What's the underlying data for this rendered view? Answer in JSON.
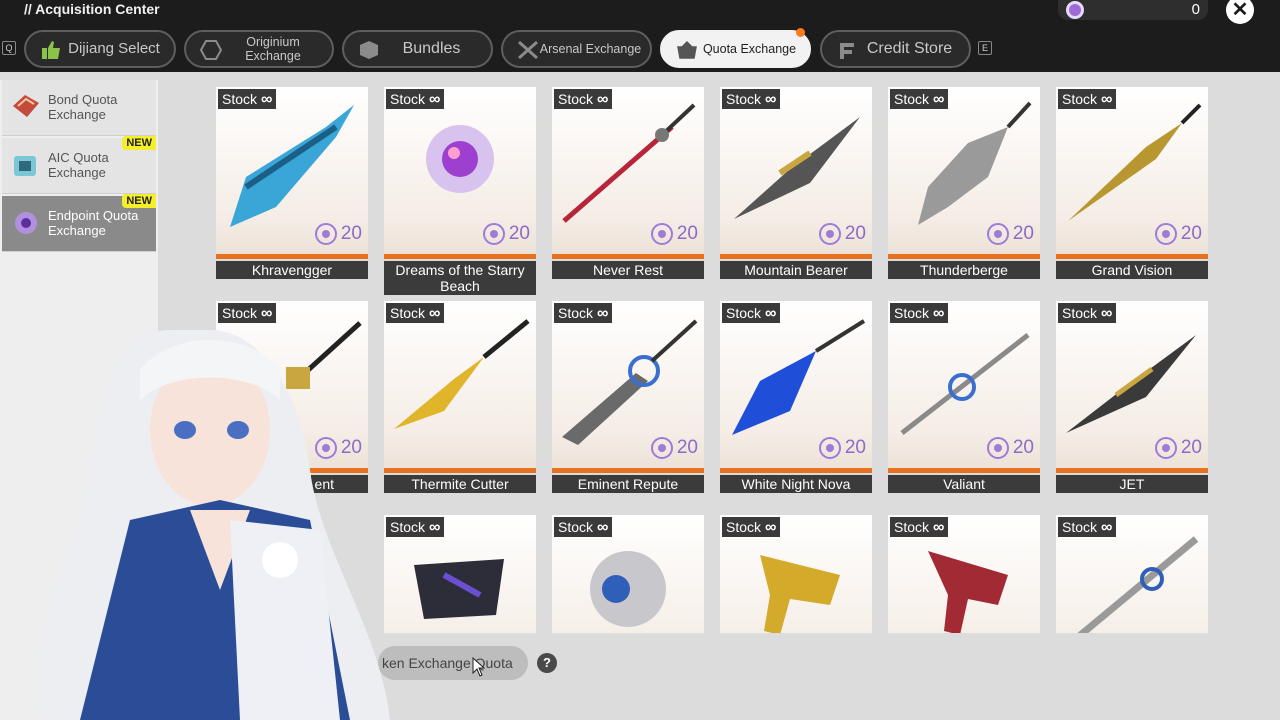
{
  "header": {
    "title": "// Acquisition Center",
    "currency_count": "0",
    "close_glyph": "✕",
    "key_left": "Q",
    "key_right": "E"
  },
  "tabs": [
    {
      "label": "Dijiang Select",
      "icon": "hand-icon",
      "active": false
    },
    {
      "label": "Originium Exchange",
      "icon": "originium-icon",
      "active": false
    },
    {
      "label": "Bundles",
      "icon": "bundle-icon",
      "active": false
    },
    {
      "label": "Arsenal Exchange",
      "icon": "crossed-swords-icon",
      "active": false
    },
    {
      "label": "Quota Exchange",
      "icon": "basket-icon",
      "active": true
    },
    {
      "label": "Credit Store",
      "icon": "credit-icon",
      "active": false
    }
  ],
  "sidebar": {
    "items": [
      {
        "label": "Bond Quota Exchange",
        "badge": "",
        "active": false
      },
      {
        "label": "AIC Quota Exchange",
        "badge": "NEW",
        "active": false
      },
      {
        "label": "Endpoint Quota Exchange",
        "badge": "NEW",
        "active": true
      }
    ]
  },
  "cards": [
    {
      "stock_label": "Stock",
      "stock_value": "∞",
      "price": "20",
      "name": "Khravengger"
    },
    {
      "stock_label": "Stock",
      "stock_value": "∞",
      "price": "20",
      "name": "Dreams of the Starry Beach"
    },
    {
      "stock_label": "Stock",
      "stock_value": "∞",
      "price": "20",
      "name": "Never Rest"
    },
    {
      "stock_label": "Stock",
      "stock_value": "∞",
      "price": "20",
      "name": "Mountain Bearer"
    },
    {
      "stock_label": "Stock",
      "stock_value": "∞",
      "price": "20",
      "name": "Thunderberge"
    },
    {
      "stock_label": "Stock",
      "stock_value": "∞",
      "price": "20",
      "name": "Grand Vision"
    },
    {
      "stock_label": "Stock",
      "stock_value": "∞",
      "price": "20",
      "name": "ent"
    },
    {
      "stock_label": "Stock",
      "stock_value": "∞",
      "price": "20",
      "name": "Thermite Cutter"
    },
    {
      "stock_label": "Stock",
      "stock_value": "∞",
      "price": "20",
      "name": "Eminent Repute"
    },
    {
      "stock_label": "Stock",
      "stock_value": "∞",
      "price": "20",
      "name": "White Night Nova"
    },
    {
      "stock_label": "Stock",
      "stock_value": "∞",
      "price": "20",
      "name": "Valiant"
    },
    {
      "stock_label": "Stock",
      "stock_value": "∞",
      "price": "20",
      "name": "JET"
    },
    {
      "stock_label": "",
      "stock_value": "",
      "price": "",
      "name": ""
    },
    {
      "stock_label": "Stock",
      "stock_value": "∞",
      "price": "",
      "name": ""
    },
    {
      "stock_label": "Stock",
      "stock_value": "∞",
      "price": "",
      "name": ""
    },
    {
      "stock_label": "Stock",
      "stock_value": "∞",
      "price": "",
      "name": ""
    },
    {
      "stock_label": "Stock",
      "stock_value": "∞",
      "price": "",
      "name": ""
    },
    {
      "stock_label": "Stock",
      "stock_value": "∞",
      "price": "",
      "name": ""
    }
  ],
  "footer": {
    "exchange_label": "ken Exchange Quota",
    "help_glyph": "?"
  },
  "colors": {
    "accent_orange": "#e8711f",
    "quota_purple": "#8d6bc6",
    "new_badge": "#f5ef2a",
    "dark_bar": "#1c1c1c"
  }
}
